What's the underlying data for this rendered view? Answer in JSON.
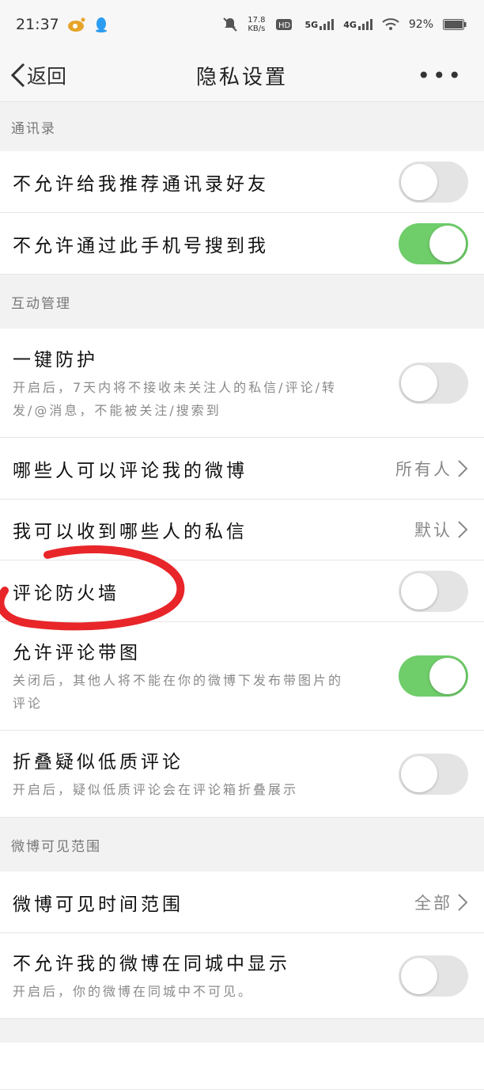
{
  "status_bar": {
    "time": "21:37",
    "speed": "17.8",
    "speed_unit": "KB/s",
    "signal1": "5G",
    "signal2": "4G",
    "battery": "92%"
  },
  "nav": {
    "back_label": "返回",
    "title": "隐私设置",
    "more_label": "•••"
  },
  "sections": {
    "contacts": {
      "title": "通讯录"
    },
    "interaction": {
      "title": "互动管理"
    },
    "visibility": {
      "title": "微博可见范围"
    }
  },
  "rows": {
    "no_recommend_contacts": {
      "label": "不允许给我推荐通讯录好友",
      "on": false
    },
    "no_search_by_phone": {
      "label": "不允许通过此手机号搜到我",
      "on": true
    },
    "one_key_protect": {
      "label": "一键防护",
      "desc_line1": "开启后，7天内将不接收未关注人的私信/评论/转",
      "desc_line2": "发/@消息，不能被关注/搜索到",
      "on": false
    },
    "who_can_comment": {
      "label": "哪些人可以评论我的微博",
      "value": "所有人"
    },
    "private_messages": {
      "label": "我可以收到哪些人的私信",
      "value": "默认"
    },
    "comment_firewall": {
      "label": "评论防火墙",
      "on": false
    },
    "allow_image_comments": {
      "label": "允许评论带图",
      "desc_line1": "关闭后，其他人将不能在你的微博下发布带图片的",
      "desc_line2": "评论",
      "on": true
    },
    "fold_low_quality": {
      "label": "折叠疑似低质评论",
      "desc_line1": "开启后，疑似低质评论会在评论箱折叠展示",
      "on": false
    },
    "visible_time_range": {
      "label": "微博可见时间范围",
      "value": "全部"
    },
    "hide_in_city": {
      "label": "不允许我的微博在同城中显示",
      "desc_line1": "开启后，你的微博在同城中不可见。",
      "on": false
    }
  },
  "colors": {
    "toggle_on": "#6fcd6a",
    "annotation": "#e8262a"
  }
}
